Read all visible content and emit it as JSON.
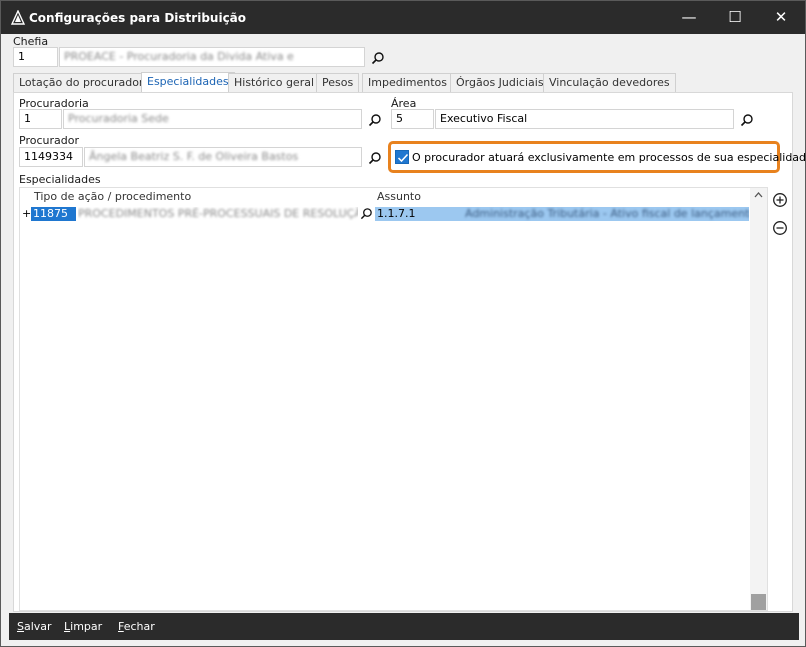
{
  "window": {
    "title": "Configurações para Distribuição",
    "minimize_glyph": "—",
    "maximize_glyph": "☐",
    "close_glyph": "✕"
  },
  "chefia": {
    "label": "Chefia",
    "code": "1",
    "name": "PROEACE - Procuradoria da Divida Ativa e"
  },
  "tabs": [
    {
      "label": "Lotação do procurador"
    },
    {
      "label": "Especialidades",
      "active": true
    },
    {
      "label": "Histórico geral"
    },
    {
      "label": "Pesos"
    },
    {
      "label": "Impedimentos"
    },
    {
      "label": "Órgãos Judiciais"
    },
    {
      "label": "Vinculação devedores"
    }
  ],
  "procuradoria": {
    "label": "Procuradoria",
    "code": "1",
    "name": "Procuradoria Sede"
  },
  "area": {
    "label": "Área",
    "code": "5",
    "name": "Executivo Fiscal"
  },
  "procurador": {
    "label": "Procurador",
    "code": "1149334",
    "name": "Ângela Beatriz S. F. de Oliveira Bastos"
  },
  "exclusive_checkbox": {
    "label": "O procurador atuará exclusivamente em processos de sua especialidade",
    "checked": true
  },
  "especialidades": {
    "label": "Especialidades",
    "columns": [
      "Tipo de ação / procedimento",
      "Assunto"
    ],
    "rows": [
      {
        "expand": "+",
        "code": "11875",
        "description": "PROCEDIMENTOS PRÉ-PROCESSUAIS DE RESOLUÇÃO C",
        "assunto_code": "1.1.7.1",
        "assunto_desc": "Administração Tributária - Ativo fiscal de lançamento - A"
      }
    ]
  },
  "footer": {
    "save": {
      "ul": "S",
      "rest": "alvar"
    },
    "clear": {
      "ul": "L",
      "rest": "impar"
    },
    "close": {
      "ul": "F",
      "rest": "echar"
    }
  },
  "colors": {
    "accent": "#1f77d0",
    "highlight": "#e8821e",
    "selection": "#9cc8f0"
  }
}
